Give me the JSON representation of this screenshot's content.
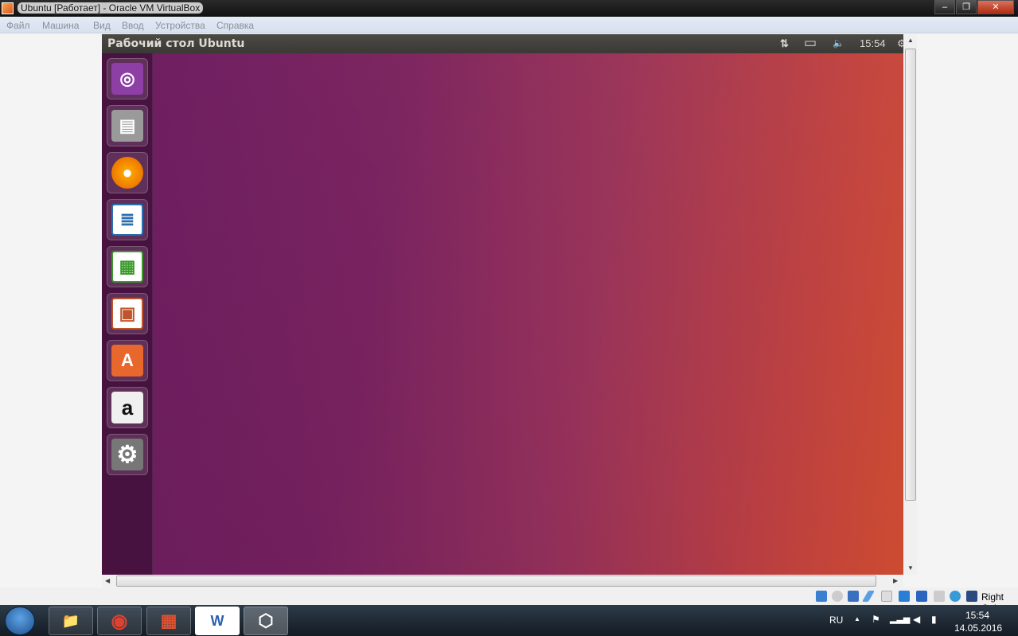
{
  "window": {
    "title": "Ubuntu [Работает] - Oracle VM VirtualBox",
    "minimize": "–",
    "restore": "❐",
    "close": "✕"
  },
  "menu": [
    "Файл",
    "Машина",
    "Вид",
    "Ввод",
    "Устройства",
    "Справка"
  ],
  "guest": {
    "panel_title": "Рабочий стол Ubuntu",
    "network_icon": "⇅",
    "battery_icon": "▭",
    "volume_icon": "🔈",
    "clock": "15:54",
    "gear_icon": "⚙",
    "launcher": [
      {
        "name": "dash",
        "glyph": "◎",
        "color": "#8d3fa5"
      },
      {
        "name": "files",
        "glyph": "▤",
        "color": "#9a9a9a"
      },
      {
        "name": "firefox",
        "glyph": "●",
        "color": "#e66000"
      },
      {
        "name": "writer",
        "glyph": "≣",
        "color": "#2a6fb0"
      },
      {
        "name": "calc",
        "glyph": "▦",
        "color": "#3a9a2a"
      },
      {
        "name": "impress",
        "glyph": "▣",
        "color": "#c0542a"
      },
      {
        "name": "software-center",
        "glyph": "A",
        "color": "#e8672c"
      },
      {
        "name": "amazon",
        "glyph": "a",
        "color": "#f0f0f0"
      },
      {
        "name": "system-settings",
        "glyph": "⚙",
        "color": "#888"
      }
    ]
  },
  "statusbar": {
    "host_key": "Right Ctrl"
  },
  "taskbar": {
    "apps": [
      {
        "name": "explorer",
        "glyph": "📁"
      },
      {
        "name": "chrome",
        "glyph": "◉"
      },
      {
        "name": "apps",
        "glyph": "▦"
      },
      {
        "name": "word",
        "glyph": "W"
      },
      {
        "name": "virtualbox",
        "glyph": "⬡"
      }
    ],
    "lang": "RU",
    "time": "15:54",
    "date": "14.05.2016"
  }
}
